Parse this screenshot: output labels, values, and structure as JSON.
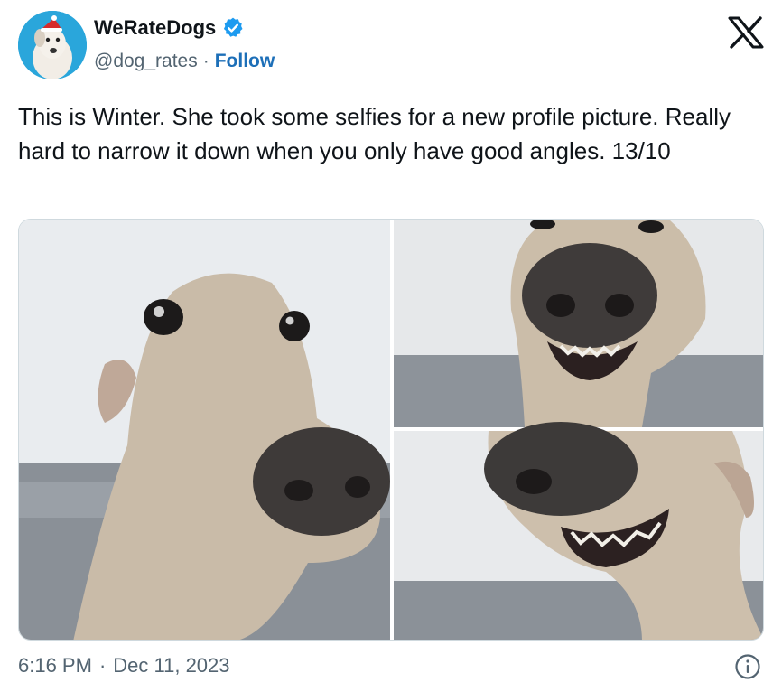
{
  "author": {
    "display_name": "WeRateDogs",
    "handle": "@dog_rates",
    "separator": "·",
    "follow_label": "Follow",
    "verified_icon": "verified-badge-icon",
    "brand_color": "#1d9bf0"
  },
  "platform_logo": "x-logo-icon",
  "tweet": {
    "text": "This is Winter. She took some selfies for a new profile picture. Really hard to narrow it down when you only have good angles. 13/10"
  },
  "media": {
    "photo_count": 3
  },
  "meta": {
    "time": "6:16 PM",
    "separator": "·",
    "date": "Dec 11, 2023",
    "info_icon": "info-icon"
  }
}
